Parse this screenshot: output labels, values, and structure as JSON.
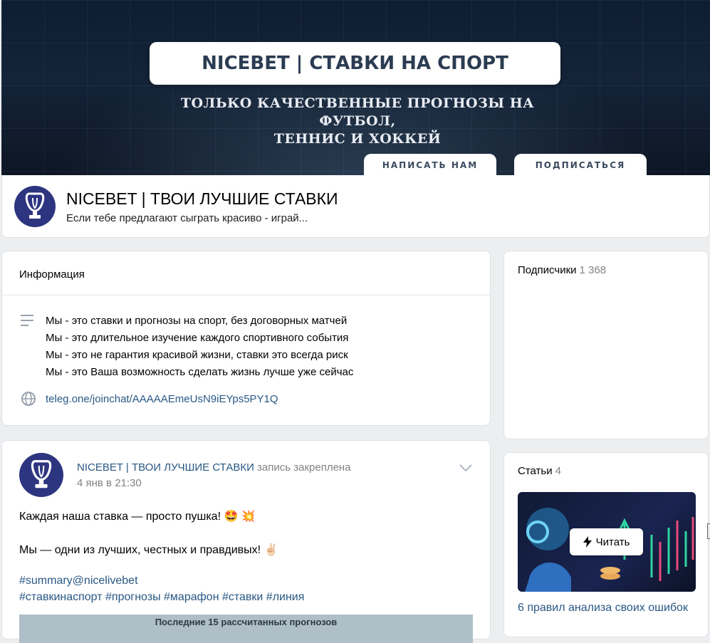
{
  "cover": {
    "title": "NICEBET | СТАВКИ НА СПОРТ",
    "subtitle_line1": "ТОЛЬКО КАЧЕСТВЕННЫЕ ПРОГНОЗЫ НА ФУТБОЛ,",
    "subtitle_line2": "ТЕННИС И ХОККЕЙ",
    "btn_write": "НАПИСАТЬ НАМ",
    "btn_subscribe": "ПОДПИСАТЬСЯ"
  },
  "group": {
    "name": "NICEBET | ТВОИ ЛУЧШИЕ СТАВКИ",
    "status": "Если тебе предлагают сыграть красиво - играй..."
  },
  "info": {
    "heading": "Информация",
    "description": [
      "Мы - это ставки и прогнозы на спорт, без договорных матчей",
      "Мы - это длительное изучение каждого спортивного события",
      "Мы - это не гарантия красивой жизни, ставки это всегда риск",
      "Мы - это Ваша возможность сделать жизнь лучше уже сейчас"
    ],
    "link": "teleg.one/joinchat/AAAAAEmeUsN9iEYps5PY1Q"
  },
  "post": {
    "author": "NICEBET | ТВОИ ЛУЧШИЕ СТАВКИ",
    "pinned": "запись закреплена",
    "date": "4 янв в 21:30",
    "line1": "Каждая наша ставка — просто пушка! 🤩 💥",
    "line2": "Мы — одни из лучших, честных и правдивых! ✌🏻",
    "tag1": "#summary@nicelivebet",
    "tag2": "#ставкинаспорт #прогнозы #марафон #ставки #линия",
    "image_caption": "Последние 15 рассчитанных прогнозов"
  },
  "members": {
    "label": "Подписчики",
    "count": "1 368"
  },
  "articles": {
    "label": "Статьи",
    "count": "4",
    "read_label": "Читать",
    "title": "6 правил анализа своих ошибок"
  },
  "icons": {
    "avatar": "trophy-icon",
    "description": "lines-icon",
    "link": "globe-icon",
    "menu": "chevron-down-icon",
    "read": "lightning-icon"
  },
  "colors": {
    "link": "#2a5885",
    "muted": "#828282",
    "avatar_bg": "#2d3580",
    "page_bg": "#edeef0"
  }
}
